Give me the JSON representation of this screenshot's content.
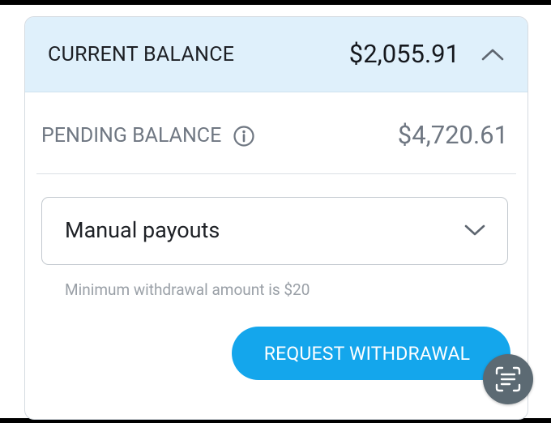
{
  "balance": {
    "current_label": "CURRENT BALANCE",
    "current_value": "$2,055.91",
    "pending_label": "PENDING BALANCE",
    "pending_value": "$4,720.61"
  },
  "payout": {
    "selected_option": "Manual payouts",
    "helper_text": "Minimum withdrawal amount is $20"
  },
  "actions": {
    "request_withdrawal_label": "REQUEST WITHDRAWAL"
  },
  "icons": {
    "collapse": "chevron-up-icon",
    "info": "info-icon",
    "dropdown": "chevron-down-icon",
    "scan": "text-scan-icon"
  },
  "colors": {
    "header_background": "#dff0fb",
    "accent_button": "#14a6ec",
    "muted_text": "#6f7782",
    "fab_background": "#5c6a73"
  }
}
